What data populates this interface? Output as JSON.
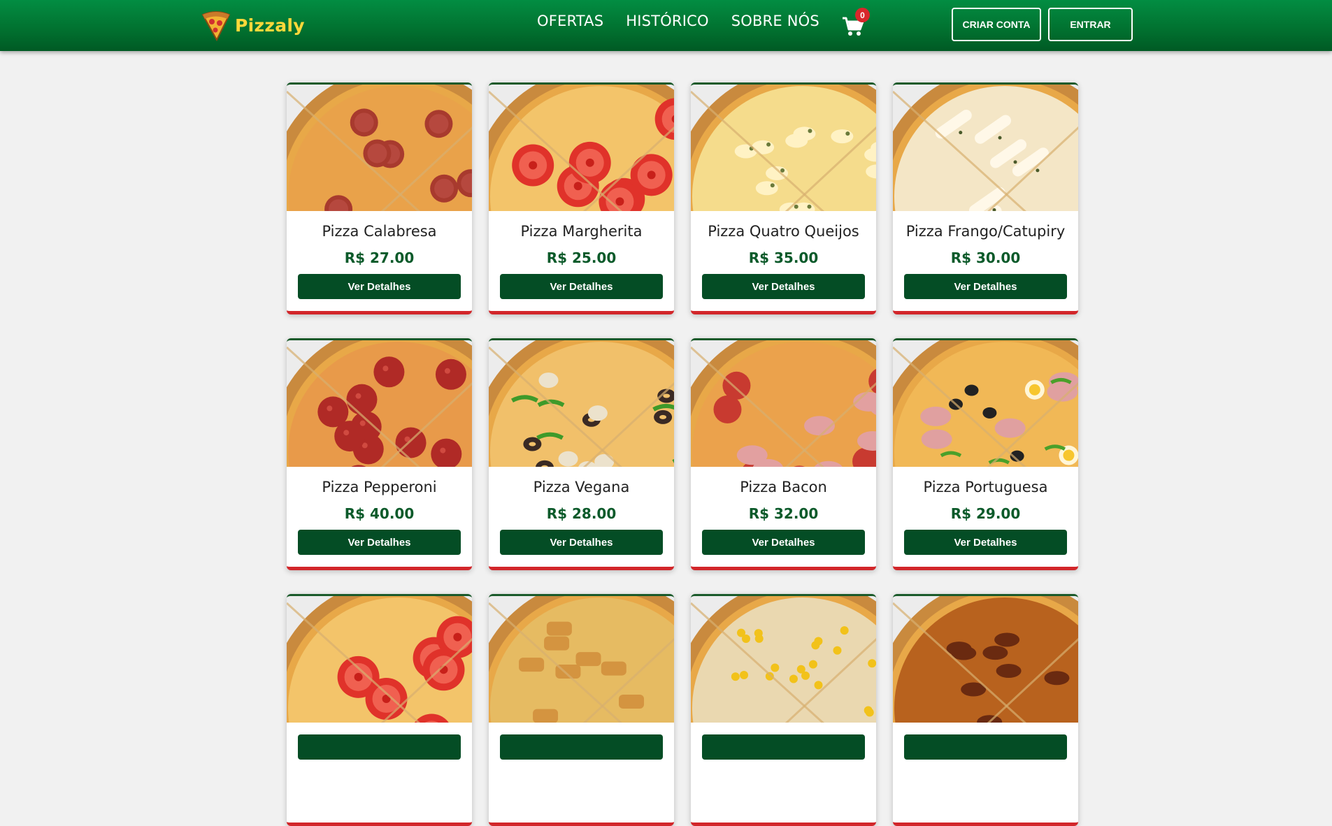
{
  "header": {
    "brand": "Pizzaly",
    "nav": [
      {
        "label": "OFERTAS"
      },
      {
        "label": "HISTÓRICO"
      },
      {
        "label": "SOBRE NÓS"
      }
    ],
    "cart_count": "0",
    "signup_label": "CRIAR CONTA",
    "login_label": "ENTRAR"
  },
  "colors": {
    "header_green": "#028d42",
    "brand_yellow": "#ffd83a",
    "button_green": "#044d25",
    "price_green": "#0b5a2a",
    "accent_red": "#d2262a"
  },
  "products": [
    {
      "name": "Pizza Calabresa",
      "price": "R$ 27.00",
      "button": "Ver Detalhes",
      "topping": "calabresa"
    },
    {
      "name": "Pizza Margherita",
      "price": "R$ 25.00",
      "button": "Ver Detalhes",
      "topping": "tomato"
    },
    {
      "name": "Pizza Quatro Queijos",
      "price": "R$ 35.00",
      "button": "Ver Detalhes",
      "topping": "cheese"
    },
    {
      "name": "Pizza Frango/Catupiry",
      "price": "R$ 30.00",
      "button": "Ver Detalhes",
      "topping": "catupiry"
    },
    {
      "name": "Pizza Pepperoni",
      "price": "R$ 40.00",
      "button": "Ver Detalhes",
      "topping": "pepperoni"
    },
    {
      "name": "Pizza Vegana",
      "price": "R$ 28.00",
      "button": "Ver Detalhes",
      "topping": "vegan"
    },
    {
      "name": "Pizza Bacon",
      "price": "R$ 32.00",
      "button": "Ver Detalhes",
      "topping": "bacon"
    },
    {
      "name": "Pizza Portuguesa",
      "price": "R$ 29.00",
      "button": "Ver Detalhes",
      "topping": "portuguesa"
    },
    {
      "name": "",
      "price": "",
      "button": "",
      "topping": "tomato"
    },
    {
      "name": "",
      "price": "",
      "button": "",
      "topping": "chicken"
    },
    {
      "name": "",
      "price": "",
      "button": "",
      "topping": "corn"
    },
    {
      "name": "",
      "price": "",
      "button": "",
      "topping": "bbq"
    }
  ]
}
